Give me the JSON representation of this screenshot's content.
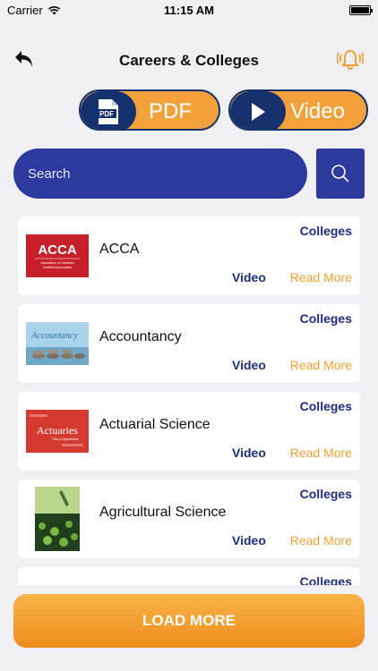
{
  "status_bar": {
    "carrier": "Carrier",
    "time": "11:15 AM"
  },
  "header": {
    "title": "Careers & Colleges"
  },
  "toggles": {
    "pdf_label": "PDF",
    "video_label": "Video"
  },
  "search": {
    "placeholder": "Search"
  },
  "colors": {
    "navy": "#15326e",
    "blue": "#2b3a9c",
    "orange": "#f3a23b"
  },
  "items": [
    {
      "name": "ACCA",
      "colleges": "Colleges",
      "video": "Video",
      "read_more": "Read More",
      "thumb_title": "ACCA",
      "thumb_sub": "Association of Chartered Certified Accountants"
    },
    {
      "name": "Accountancy",
      "colleges": "Colleges",
      "video": "Video",
      "read_more": "Read More",
      "thumb_title": "Accountancy"
    },
    {
      "name": "Actuarial Science",
      "colleges": "Colleges",
      "video": "Video",
      "read_more": "Read More",
      "thumb_title": "Actuaries",
      "thumb_sub": "Risk is Opportunity"
    },
    {
      "name": "Agricultural Science",
      "colleges": "Colleges",
      "video": "Video",
      "read_more": "Read More"
    },
    {
      "colleges": "Colleges"
    }
  ],
  "load_more": "LOAD MORE"
}
